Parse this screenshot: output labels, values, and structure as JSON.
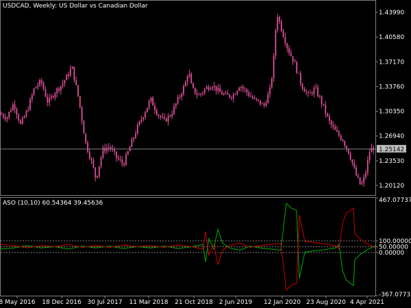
{
  "header": {
    "main_title": "USDCAD, Weekly:  US Dollar vs Canadian Dollar",
    "indicator_title": "ASO (10,10) 60.54364 39.45636"
  },
  "current_price": "1.25142",
  "colors": {
    "background": "#000000",
    "frame": "#808080",
    "candle": "#e0509a",
    "bull_line": "#00b000",
    "bear_line": "#d00000",
    "level_line": "#808080",
    "price_badge_bg": "#c0c0c0"
  },
  "chart_data": [
    {
      "type": "candlestick",
      "title": "USDCAD, Weekly:  US Dollar vs Canadian Dollar",
      "y_ticks": [
        "1.43990",
        "1.40580",
        "1.37170",
        "1.33760",
        "1.30350",
        "1.26940",
        "1.23530",
        "1.20120"
      ],
      "x_ticks": [
        "8 May 2016",
        "18 Dec 2016",
        "30 Jul 2017",
        "11 Mar 2018",
        "21 Oct 2018",
        "2 Jun 2019",
        "12 Jan 2020",
        "23 Aug 2020",
        "4 Apr 2021"
      ],
      "ylim": [
        1.188,
        1.456
      ],
      "current_price": 1.25142,
      "path_keypoints": [
        [
          0,
          1.3
        ],
        [
          10,
          1.295
        ],
        [
          20,
          1.315
        ],
        [
          30,
          1.285
        ],
        [
          40,
          1.305
        ],
        [
          50,
          1.335
        ],
        [
          60,
          1.345
        ],
        [
          70,
          1.315
        ],
        [
          80,
          1.33
        ],
        [
          90,
          1.34
        ],
        [
          100,
          1.355
        ],
        [
          105,
          1.365
        ],
        [
          115,
          1.32
        ],
        [
          125,
          1.26
        ],
        [
          135,
          1.23
        ],
        [
          140,
          1.21
        ],
        [
          150,
          1.25
        ],
        [
          160,
          1.255
        ],
        [
          170,
          1.24
        ],
        [
          180,
          1.23
        ],
        [
          190,
          1.255
        ],
        [
          200,
          1.28
        ],
        [
          210,
          1.3
        ],
        [
          220,
          1.32
        ],
        [
          230,
          1.3
        ],
        [
          240,
          1.29
        ],
        [
          250,
          1.3
        ],
        [
          260,
          1.32
        ],
        [
          270,
          1.34
        ],
        [
          275,
          1.36
        ],
        [
          280,
          1.335
        ],
        [
          290,
          1.325
        ],
        [
          300,
          1.335
        ],
        [
          310,
          1.34
        ],
        [
          320,
          1.33
        ],
        [
          330,
          1.325
        ],
        [
          340,
          1.325
        ],
        [
          350,
          1.34
        ],
        [
          360,
          1.33
        ],
        [
          370,
          1.32
        ],
        [
          380,
          1.315
        ],
        [
          385,
          1.31
        ],
        [
          395,
          1.335
        ],
        [
          400,
          1.38
        ],
        [
          404,
          1.44
        ],
        [
          410,
          1.42
        ],
        [
          420,
          1.39
        ],
        [
          430,
          1.37
        ],
        [
          440,
          1.34
        ],
        [
          450,
          1.325
        ],
        [
          460,
          1.335
        ],
        [
          470,
          1.315
        ],
        [
          480,
          1.29
        ],
        [
          490,
          1.275
        ],
        [
          500,
          1.265
        ],
        [
          510,
          1.245
        ],
        [
          520,
          1.215
        ],
        [
          527,
          1.2
        ],
        [
          533,
          1.215
        ],
        [
          540,
          1.25
        ],
        [
          548,
          1.255
        ]
      ]
    },
    {
      "type": "line",
      "title": "ASO (10,10) 60.54364 39.45636",
      "y_ticks": [
        "467.07737",
        "100.00000",
        "50.00000",
        "0.00000",
        "-367.07737"
      ],
      "ylim": [
        -367.07737,
        467.07737
      ],
      "levels": [
        100,
        50,
        0
      ],
      "series": [
        {
          "color": "#00b000",
          "keypoints": [
            [
              0,
              30
            ],
            [
              20,
              40
            ],
            [
              40,
              60
            ],
            [
              60,
              40
            ],
            [
              80,
              50
            ],
            [
              100,
              30
            ],
            [
              120,
              55
            ],
            [
              140,
              40
            ],
            [
              160,
              55
            ],
            [
              180,
              35
            ],
            [
              200,
              50
            ],
            [
              220,
              40
            ],
            [
              240,
              55
            ],
            [
              260,
              35
            ],
            [
              280,
              50
            ],
            [
              296,
              70
            ],
            [
              300,
              -80
            ],
            [
              305,
              120
            ],
            [
              312,
              30
            ],
            [
              318,
              200
            ],
            [
              325,
              80
            ],
            [
              335,
              40
            ],
            [
              350,
              20
            ],
            [
              365,
              55
            ],
            [
              380,
              40
            ],
            [
              395,
              30
            ],
            [
              410,
              20
            ],
            [
              418,
              420
            ],
            [
              425,
              380
            ],
            [
              433,
              360
            ],
            [
              437,
              -220
            ],
            [
              445,
              5
            ],
            [
              460,
              15
            ],
            [
              480,
              30
            ],
            [
              490,
              40
            ],
            [
              495,
              70
            ],
            [
              500,
              -150
            ],
            [
              505,
              -230
            ],
            [
              512,
              -265
            ],
            [
              516,
              -280
            ],
            [
              518,
              -60
            ],
            [
              525,
              -20
            ],
            [
              535,
              20
            ],
            [
              548,
              60
            ]
          ]
        },
        {
          "color": "#d00000",
          "keypoints": [
            [
              0,
              70
            ],
            [
              20,
              60
            ],
            [
              40,
              40
            ],
            [
              60,
              60
            ],
            [
              80,
              50
            ],
            [
              100,
              70
            ],
            [
              120,
              45
            ],
            [
              140,
              60
            ],
            [
              160,
              45
            ],
            [
              180,
              65
            ],
            [
              200,
              50
            ],
            [
              220,
              60
            ],
            [
              240,
              45
            ],
            [
              260,
              65
            ],
            [
              280,
              50
            ],
            [
              296,
              30
            ],
            [
              300,
              180
            ],
            [
              305,
              -20
            ],
            [
              312,
              70
            ],
            [
              318,
              -100
            ],
            [
              325,
              20
            ],
            [
              335,
              60
            ],
            [
              350,
              80
            ],
            [
              365,
              45
            ],
            [
              380,
              60
            ],
            [
              395,
              70
            ],
            [
              410,
              80
            ],
            [
              418,
              -320
            ],
            [
              425,
              -280
            ],
            [
              433,
              -260
            ],
            [
              437,
              320
            ],
            [
              445,
              95
            ],
            [
              460,
              85
            ],
            [
              480,
              70
            ],
            [
              490,
              60
            ],
            [
              495,
              30
            ],
            [
              500,
              250
            ],
            [
              505,
              330
            ],
            [
              512,
              365
            ],
            [
              516,
              380
            ],
            [
              518,
              160
            ],
            [
              525,
              120
            ],
            [
              535,
              80
            ],
            [
              548,
              40
            ]
          ]
        }
      ]
    }
  ]
}
